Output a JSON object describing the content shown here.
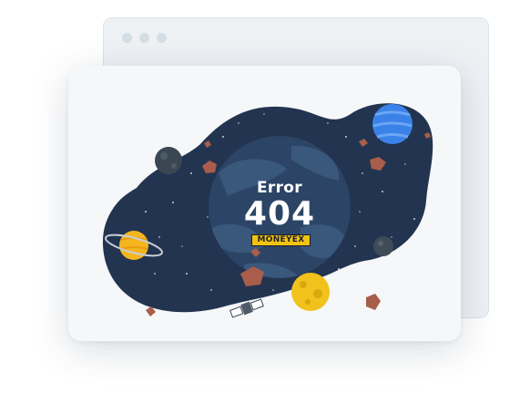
{
  "error": {
    "label": "Error",
    "code": "404"
  },
  "brand": {
    "name": "MONEYEX"
  },
  "colors": {
    "space": "#223450",
    "planet_blue": "#3b82e8",
    "saturn": "#f5b51f",
    "moon": "#f1c21c",
    "brand_bg": "#f2c312"
  }
}
